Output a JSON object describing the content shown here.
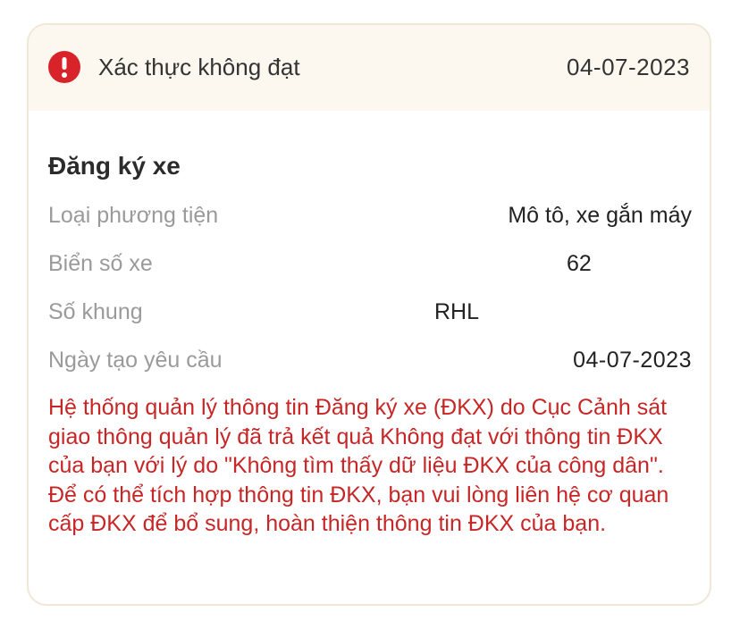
{
  "header": {
    "status_text": "Xác thực không đạt",
    "date": "04-07-2023",
    "icon": "alert-circle-icon",
    "status_color": "#d8232a"
  },
  "section": {
    "title": "Đăng ký xe"
  },
  "rows": [
    {
      "label": "Loại phương tiện",
      "value": "Mô tô, xe gắn máy"
    },
    {
      "label": "Biển số xe",
      "value": "62"
    },
    {
      "label": "Số khung",
      "value": "RHL"
    },
    {
      "label": "Ngày tạo yêu cầu",
      "value": "04-07-2023"
    }
  ],
  "note": {
    "text": "Hệ thống quản lý thông tin Đăng ký xe (ĐKX) do Cục Cảnh sát giao thông quản lý đã trả kết quả Không đạt với thông tin ĐKX của bạn với lý do \"Không tìm thấy dữ liệu ĐKX của công dân\". Để có thể tích hợp thông tin ĐKX, bạn vui lòng liên hệ cơ quan cấp ĐKX để bổ sung, hoàn thiện thông tin ĐKX của bạn.",
    "color": "#c72626"
  }
}
